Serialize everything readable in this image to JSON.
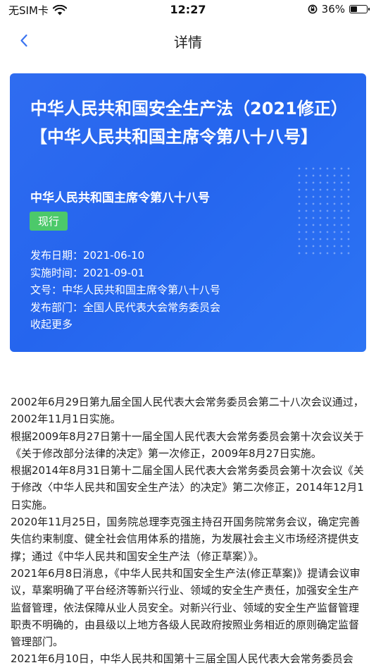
{
  "status_bar": {
    "carrier": "无SIM卡",
    "time": "12:27",
    "battery": "36%",
    "battery_level": 0.36
  },
  "nav": {
    "title": "详情"
  },
  "card": {
    "title": "中华人民共和国安全生产法（2021修正）【中华人民共和国主席令第八十八号】",
    "subtitle": "中华人民共和国主席令第八十八号",
    "status_badge": "现行",
    "meta": [
      {
        "label": "发布日期：",
        "value": "2021-06-10"
      },
      {
        "label": "实施时间：",
        "value": "2021-09-01"
      },
      {
        "label": "文号：",
        "value": "中华人民共和国主席令第八十八号"
      },
      {
        "label": "发布部门：",
        "value": "全国人民代表大会常务委员会"
      }
    ],
    "collapse_label": "收起更多"
  },
  "content": {
    "paragraphs": [
      "2002年6月29日第九届全国人民代表大会常务委员会第二十八次会议通过，2002年11月1日实施。",
      "根据2009年8月27日第十一届全国人民代表大会常务委员会第十次会议关于《关于修改部分法律的决定》第一次修正，2009年8月27日实施。",
      "根据2014年8月31日第十二届全国人民代表大会常务委员会第十次会议《关于修改〈中华人民共和国安全生产法〉的决定》第二次修正，2014年12月1日实施。",
      "2020年11月25日，国务院总理李克强主持召开国务院常务会议，确定完善失信约束制度、健全社会信用体系的措施，为发展社会主义市场经济提供支撑；通过《中华人民共和国安全生产法（修正草案）》。",
      "2021年6月8日消息，《中华人民共和国安全生产法(修正草案)》提请会议审议，草案明确了平台经济等新兴行业、领域的安全生产责任，加强安全生产监督管理，依法保障从业人员安全。对新兴行业、领域的安全生产监督管理职责不明确的，由县级以上地方各级人民政府按照业务相近的原则确定监督管理部门。",
      "2021年6月10日，中华人民共和国第十三届全国人民代表大会常务委员会"
    ]
  }
}
